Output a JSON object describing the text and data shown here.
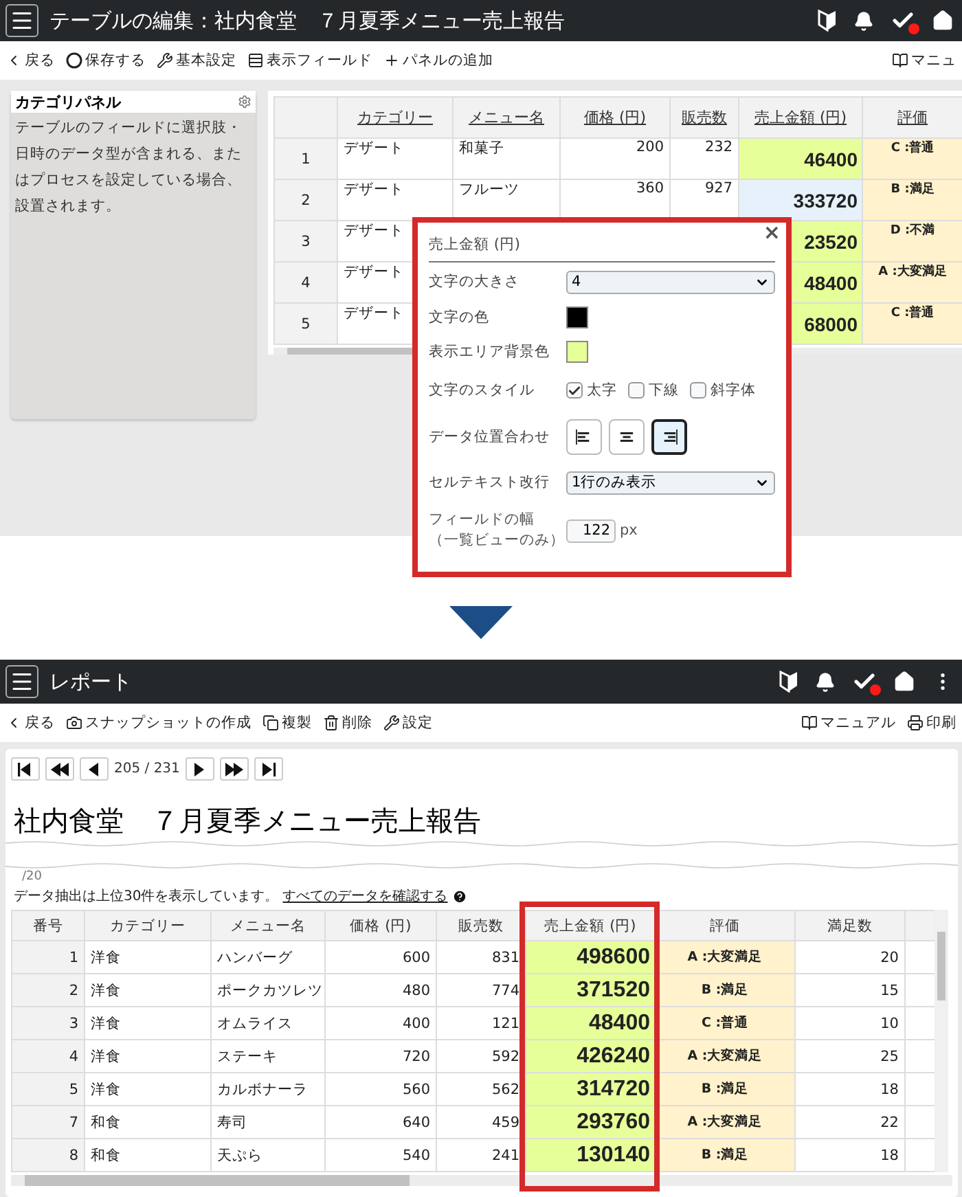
{
  "edit_screen": {
    "title": "テーブルの編集：社内食堂　７月夏季メニュー売上報告",
    "toolbar": [
      {
        "kind": "back",
        "label": "戻る"
      },
      {
        "kind": "save",
        "label": "保存する"
      },
      {
        "kind": "settings",
        "label": "基本設定"
      },
      {
        "kind": "fields",
        "label": "表示フィールド"
      },
      {
        "kind": "add",
        "label": "パネルの追加"
      }
    ],
    "toolbar_right": {
      "kind": "manual",
      "label": "マニュ"
    },
    "category_panel": {
      "title": "カテゴリパネル",
      "text": "テーブルのフィールドに選択肢・日時のデータ型が含まれる、またはプロセスを設定している場合、設置されます。"
    },
    "table": {
      "columns": [
        "カテゴリー",
        "メニュー名",
        "価格 (円)",
        "販売数",
        "売上金額 (円)",
        "評価"
      ],
      "rows": [
        {
          "number": "1",
          "category": "デザート",
          "menu": "和菓子",
          "price": "200",
          "qty": "232",
          "sales": "46400",
          "rating": "C :普通",
          "selected": false
        },
        {
          "number": "2",
          "category": "デザート",
          "menu": "フルーツ",
          "price": "360",
          "qty": "927",
          "sales": "333720",
          "rating": "B :満足",
          "selected": true
        },
        {
          "number": "3",
          "category": "デザート",
          "sales": "23520",
          "rating": "D :不満",
          "selected": false
        },
        {
          "number": "4",
          "category": "デザート",
          "sales": "48400",
          "rating": "A :大変満足",
          "selected": false
        },
        {
          "number": "5",
          "category": "デザート",
          "sales": "68000",
          "rating": "C :普通",
          "selected": false
        }
      ]
    },
    "popup": {
      "title": "売上金額 (円)",
      "close": "×",
      "font_size": {
        "label": "文字の大きさ",
        "value": "4"
      },
      "text_color": {
        "label": "文字の色",
        "color": "#000000"
      },
      "background_color": {
        "label": "表示エリア背景色",
        "color": "#e6ff99"
      },
      "text_style": {
        "label": "文字のスタイル",
        "options": [
          {
            "label": "太字",
            "checked": true
          },
          {
            "label": "下線",
            "checked": false
          },
          {
            "label": "斜字体",
            "checked": false
          }
        ]
      },
      "alignment": {
        "label": "データ位置合わせ",
        "options": [
          {
            "kind": "left",
            "selected": false
          },
          {
            "kind": "center",
            "selected": false
          },
          {
            "kind": "right",
            "selected": true
          }
        ]
      },
      "wrap": {
        "label": "セルテキスト改行",
        "value": "1行のみ表示"
      },
      "width": {
        "label": "フィールドの幅",
        "note": "（一覧ビューのみ）",
        "value": "122",
        "unit": "px"
      }
    }
  },
  "report_screen": {
    "title": "レポート",
    "toolbar": [
      {
        "kind": "back",
        "label": "戻る"
      },
      {
        "kind": "snapshot",
        "label": "スナップショットの作成"
      },
      {
        "kind": "copy",
        "label": "複製"
      },
      {
        "kind": "delete",
        "label": "削除"
      },
      {
        "kind": "settings",
        "label": "設定"
      }
    ],
    "toolbar_right": [
      {
        "kind": "manual",
        "label": "マニュアル"
      },
      {
        "kind": "print",
        "label": "印刷"
      }
    ],
    "pager": "205 / 231",
    "heading": "社内食堂　７月夏季メニュー売上報告",
    "cut_text": "/20",
    "notice": "データ抽出は上位30件を表示しています。",
    "notice_link": "すべてのデータを確認する",
    "table": {
      "columns": [
        "番号",
        "カテゴリー",
        "メニュー名",
        "価格 (円)",
        "販売数",
        "売上金額 (円)",
        "評価",
        "満足数"
      ],
      "rows": [
        {
          "number": "1",
          "category": "洋食",
          "menu": "ハンバーグ",
          "price": "600",
          "qty": "831",
          "sales": "498600",
          "rating": "A :大変満足",
          "satisfied": "20"
        },
        {
          "number": "2",
          "category": "洋食",
          "menu": "ポークカツレツ",
          "price": "480",
          "qty": "774",
          "sales": "371520",
          "rating": "B :満足",
          "satisfied": "15"
        },
        {
          "number": "3",
          "category": "洋食",
          "menu": "オムライス",
          "price": "400",
          "qty": "121",
          "sales": "48400",
          "rating": "C :普通",
          "satisfied": "10"
        },
        {
          "number": "4",
          "category": "洋食",
          "menu": "ステーキ",
          "price": "720",
          "qty": "592",
          "sales": "426240",
          "rating": "A :大変満足",
          "satisfied": "25"
        },
        {
          "number": "5",
          "category": "洋食",
          "menu": "カルボナーラ",
          "price": "560",
          "qty": "562",
          "sales": "314720",
          "rating": "B :満足",
          "satisfied": "18"
        },
        {
          "number": "7",
          "category": "和食",
          "menu": "寿司",
          "price": "640",
          "qty": "459",
          "sales": "293760",
          "rating": "A :大変満足",
          "satisfied": "22"
        },
        {
          "number": "8",
          "category": "和食",
          "menu": "天ぷら",
          "price": "540",
          "qty": "241",
          "sales": "130140",
          "rating": "B :満足",
          "satisfied": "18"
        }
      ]
    }
  }
}
